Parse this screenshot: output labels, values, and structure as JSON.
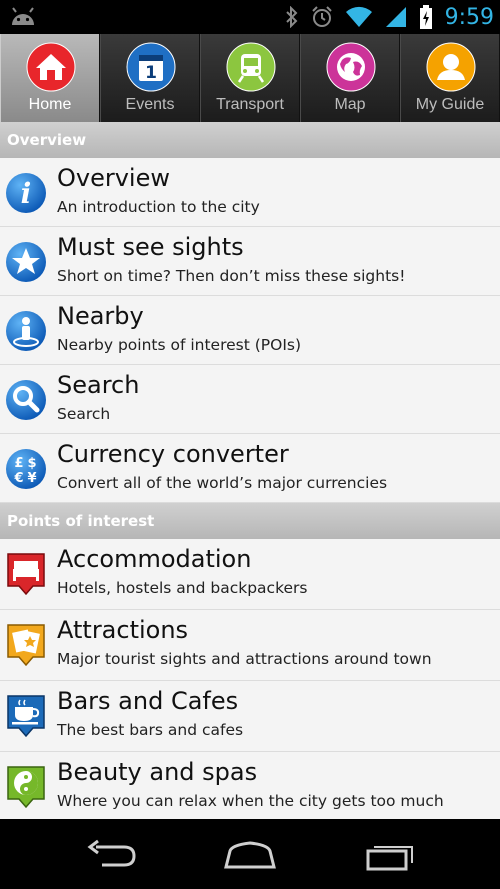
{
  "status": {
    "time": "9:59"
  },
  "tabs": [
    {
      "label": "Home",
      "icon": "home-icon",
      "color": "#e8262b",
      "active": true
    },
    {
      "label": "Events",
      "icon": "calendar-icon",
      "color": "#1f6fc4"
    },
    {
      "label": "Transport",
      "icon": "train-icon",
      "color": "#8cc63f"
    },
    {
      "label": "Map",
      "icon": "globe-icon",
      "color": "#cc3399"
    },
    {
      "label": "My Guide",
      "icon": "person-icon",
      "color": "#f5a200"
    }
  ],
  "sections": {
    "overview": {
      "header": "Overview",
      "items": [
        {
          "title": "Overview",
          "subtitle": "An introduction to the city",
          "icon": "info-icon"
        },
        {
          "title": "Must see sights",
          "subtitle": "Short on time? Then don’t miss these sights!",
          "icon": "star-icon"
        },
        {
          "title": "Nearby",
          "subtitle": "Nearby points of interest (POIs)",
          "icon": "nearby-person-icon"
        },
        {
          "title": "Search",
          "subtitle": "Search",
          "icon": "magnifier-icon"
        },
        {
          "title": "Currency converter",
          "subtitle": "Convert all of the world’s major currencies",
          "icon": "currency-icon"
        }
      ]
    },
    "poi": {
      "header": "Points of interest",
      "items": [
        {
          "title": "Accommodation",
          "subtitle": "Hotels, hostels and backpackers",
          "icon": "bed-icon",
          "color": "#d9262a"
        },
        {
          "title": "Attractions",
          "subtitle": "Major tourist sights and attractions around town",
          "icon": "tickets-icon",
          "color": "#f2a81d"
        },
        {
          "title": "Bars and Cafes",
          "subtitle": "The best bars and cafes",
          "icon": "coffee-cup-icon",
          "color": "#1c6ab8"
        },
        {
          "title": "Beauty and spas",
          "subtitle": "Where you can relax when the city gets too much",
          "icon": "yin-yang-icon",
          "color": "#76b82a"
        }
      ]
    }
  }
}
